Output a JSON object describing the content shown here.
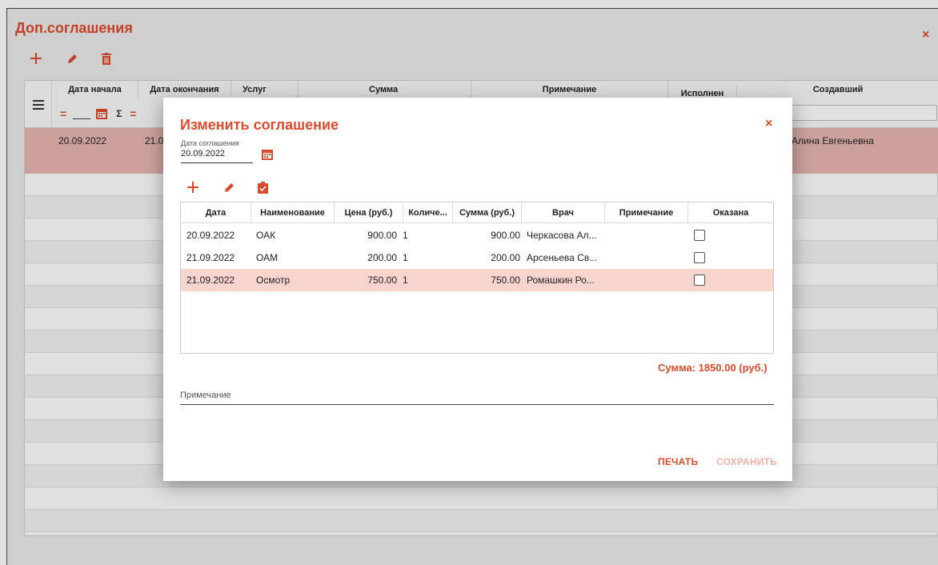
{
  "page": {
    "title": "Доп.соглашения",
    "close_icon": "×",
    "toolbar": {
      "add_icon": "plus-icon",
      "edit_icon": "pencil-icon",
      "delete_icon": "trash-icon"
    }
  },
  "grid": {
    "columns": [
      "Дата начала",
      "Дата окончания",
      "Услуг",
      "Сумма",
      "Примечание",
      "Исполнен",
      "Создавший"
    ],
    "filter": {
      "eq1": "=",
      "sigma": "Σ",
      "eq2": "="
    },
    "row": {
      "start": "20.09.2022",
      "end_partial": "21.0",
      "creator": "Алина Евгеньевна"
    }
  },
  "modal": {
    "title": "Изменить соглашение",
    "close_icon": "×",
    "date_label": "Дата соглашения",
    "date_value": "20.09.2022",
    "table": {
      "headers": [
        "Дата",
        "Наименование",
        "Цена (руб.)",
        "Количе...",
        "Сумма (руб.)",
        "Врач",
        "Примечание",
        "Оказана"
      ],
      "rows": [
        {
          "date": "20.09.2022",
          "name": "ОАК",
          "price": "900.00",
          "qty": "1",
          "sum": "900.00",
          "doctor": "Черкасова Ал...",
          "note": "",
          "done": false
        },
        {
          "date": "21.09.2022",
          "name": "ОАМ",
          "price": "200.00",
          "qty": "1",
          "sum": "200.00",
          "doctor": "Арсеньева Св...",
          "note": "",
          "done": false
        },
        {
          "date": "21.09.2022",
          "name": "Осмотр",
          "price": "750.00",
          "qty": "1",
          "sum": "750.00",
          "doctor": "Ромашкин Ро...",
          "note": "",
          "done": false
        }
      ]
    },
    "total": "Сумма: 1850.00 (руб.)",
    "note_label": "Примечание",
    "print_label": "ПЕЧАТЬ",
    "save_label": "СОХРАНИТЬ"
  },
  "colors": {
    "accent": "#dd4b2c",
    "selected_row": "#e9b8b2",
    "selected_row_modal": "#f8d4cf",
    "save_disabled": "#f0b3a6"
  }
}
